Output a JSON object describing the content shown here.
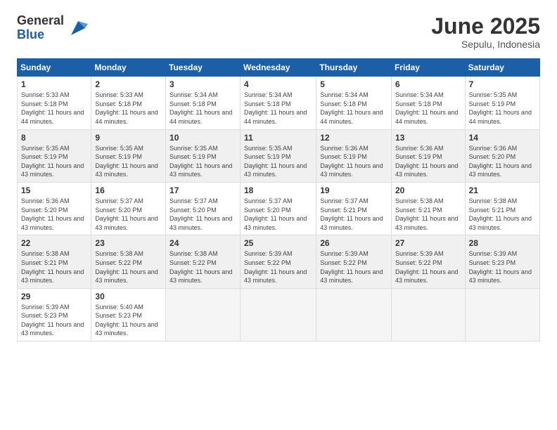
{
  "logo": {
    "general": "General",
    "blue": "Blue"
  },
  "header": {
    "month": "June 2025",
    "location": "Sepulu, Indonesia"
  },
  "weekdays": [
    "Sunday",
    "Monday",
    "Tuesday",
    "Wednesday",
    "Thursday",
    "Friday",
    "Saturday"
  ],
  "weeks": [
    [
      {
        "day": 1,
        "sunrise": "5:33 AM",
        "sunset": "5:18 PM",
        "daylight": "11 hours and 44 minutes."
      },
      {
        "day": 2,
        "sunrise": "5:33 AM",
        "sunset": "5:18 PM",
        "daylight": "11 hours and 44 minutes."
      },
      {
        "day": 3,
        "sunrise": "5:34 AM",
        "sunset": "5:18 PM",
        "daylight": "11 hours and 44 minutes."
      },
      {
        "day": 4,
        "sunrise": "5:34 AM",
        "sunset": "5:18 PM",
        "daylight": "11 hours and 44 minutes."
      },
      {
        "day": 5,
        "sunrise": "5:34 AM",
        "sunset": "5:18 PM",
        "daylight": "11 hours and 44 minutes."
      },
      {
        "day": 6,
        "sunrise": "5:34 AM",
        "sunset": "5:18 PM",
        "daylight": "11 hours and 44 minutes."
      },
      {
        "day": 7,
        "sunrise": "5:35 AM",
        "sunset": "5:19 PM",
        "daylight": "11 hours and 44 minutes."
      }
    ],
    [
      {
        "day": 8,
        "sunrise": "5:35 AM",
        "sunset": "5:19 PM",
        "daylight": "11 hours and 43 minutes."
      },
      {
        "day": 9,
        "sunrise": "5:35 AM",
        "sunset": "5:19 PM",
        "daylight": "11 hours and 43 minutes."
      },
      {
        "day": 10,
        "sunrise": "5:35 AM",
        "sunset": "5:19 PM",
        "daylight": "11 hours and 43 minutes."
      },
      {
        "day": 11,
        "sunrise": "5:35 AM",
        "sunset": "5:19 PM",
        "daylight": "11 hours and 43 minutes."
      },
      {
        "day": 12,
        "sunrise": "5:36 AM",
        "sunset": "5:19 PM",
        "daylight": "11 hours and 43 minutes."
      },
      {
        "day": 13,
        "sunrise": "5:36 AM",
        "sunset": "5:19 PM",
        "daylight": "11 hours and 43 minutes."
      },
      {
        "day": 14,
        "sunrise": "5:36 AM",
        "sunset": "5:20 PM",
        "daylight": "11 hours and 43 minutes."
      }
    ],
    [
      {
        "day": 15,
        "sunrise": "5:36 AM",
        "sunset": "5:20 PM",
        "daylight": "11 hours and 43 minutes."
      },
      {
        "day": 16,
        "sunrise": "5:37 AM",
        "sunset": "5:20 PM",
        "daylight": "11 hours and 43 minutes."
      },
      {
        "day": 17,
        "sunrise": "5:37 AM",
        "sunset": "5:20 PM",
        "daylight": "11 hours and 43 minutes."
      },
      {
        "day": 18,
        "sunrise": "5:37 AM",
        "sunset": "5:20 PM",
        "daylight": "11 hours and 43 minutes."
      },
      {
        "day": 19,
        "sunrise": "5:37 AM",
        "sunset": "5:21 PM",
        "daylight": "11 hours and 43 minutes."
      },
      {
        "day": 20,
        "sunrise": "5:38 AM",
        "sunset": "5:21 PM",
        "daylight": "11 hours and 43 minutes."
      },
      {
        "day": 21,
        "sunrise": "5:38 AM",
        "sunset": "5:21 PM",
        "daylight": "11 hours and 43 minutes."
      }
    ],
    [
      {
        "day": 22,
        "sunrise": "5:38 AM",
        "sunset": "5:21 PM",
        "daylight": "11 hours and 43 minutes."
      },
      {
        "day": 23,
        "sunrise": "5:38 AM",
        "sunset": "5:22 PM",
        "daylight": "11 hours and 43 minutes."
      },
      {
        "day": 24,
        "sunrise": "5:38 AM",
        "sunset": "5:22 PM",
        "daylight": "11 hours and 43 minutes."
      },
      {
        "day": 25,
        "sunrise": "5:39 AM",
        "sunset": "5:22 PM",
        "daylight": "11 hours and 43 minutes."
      },
      {
        "day": 26,
        "sunrise": "5:39 AM",
        "sunset": "5:22 PM",
        "daylight": "11 hours and 43 minutes."
      },
      {
        "day": 27,
        "sunrise": "5:39 AM",
        "sunset": "5:22 PM",
        "daylight": "11 hours and 43 minutes."
      },
      {
        "day": 28,
        "sunrise": "5:39 AM",
        "sunset": "5:23 PM",
        "daylight": "11 hours and 43 minutes."
      }
    ],
    [
      {
        "day": 29,
        "sunrise": "5:39 AM",
        "sunset": "5:23 PM",
        "daylight": "11 hours and 43 minutes."
      },
      {
        "day": 30,
        "sunrise": "5:40 AM",
        "sunset": "5:23 PM",
        "daylight": "11 hours and 43 minutes."
      },
      null,
      null,
      null,
      null,
      null
    ]
  ]
}
